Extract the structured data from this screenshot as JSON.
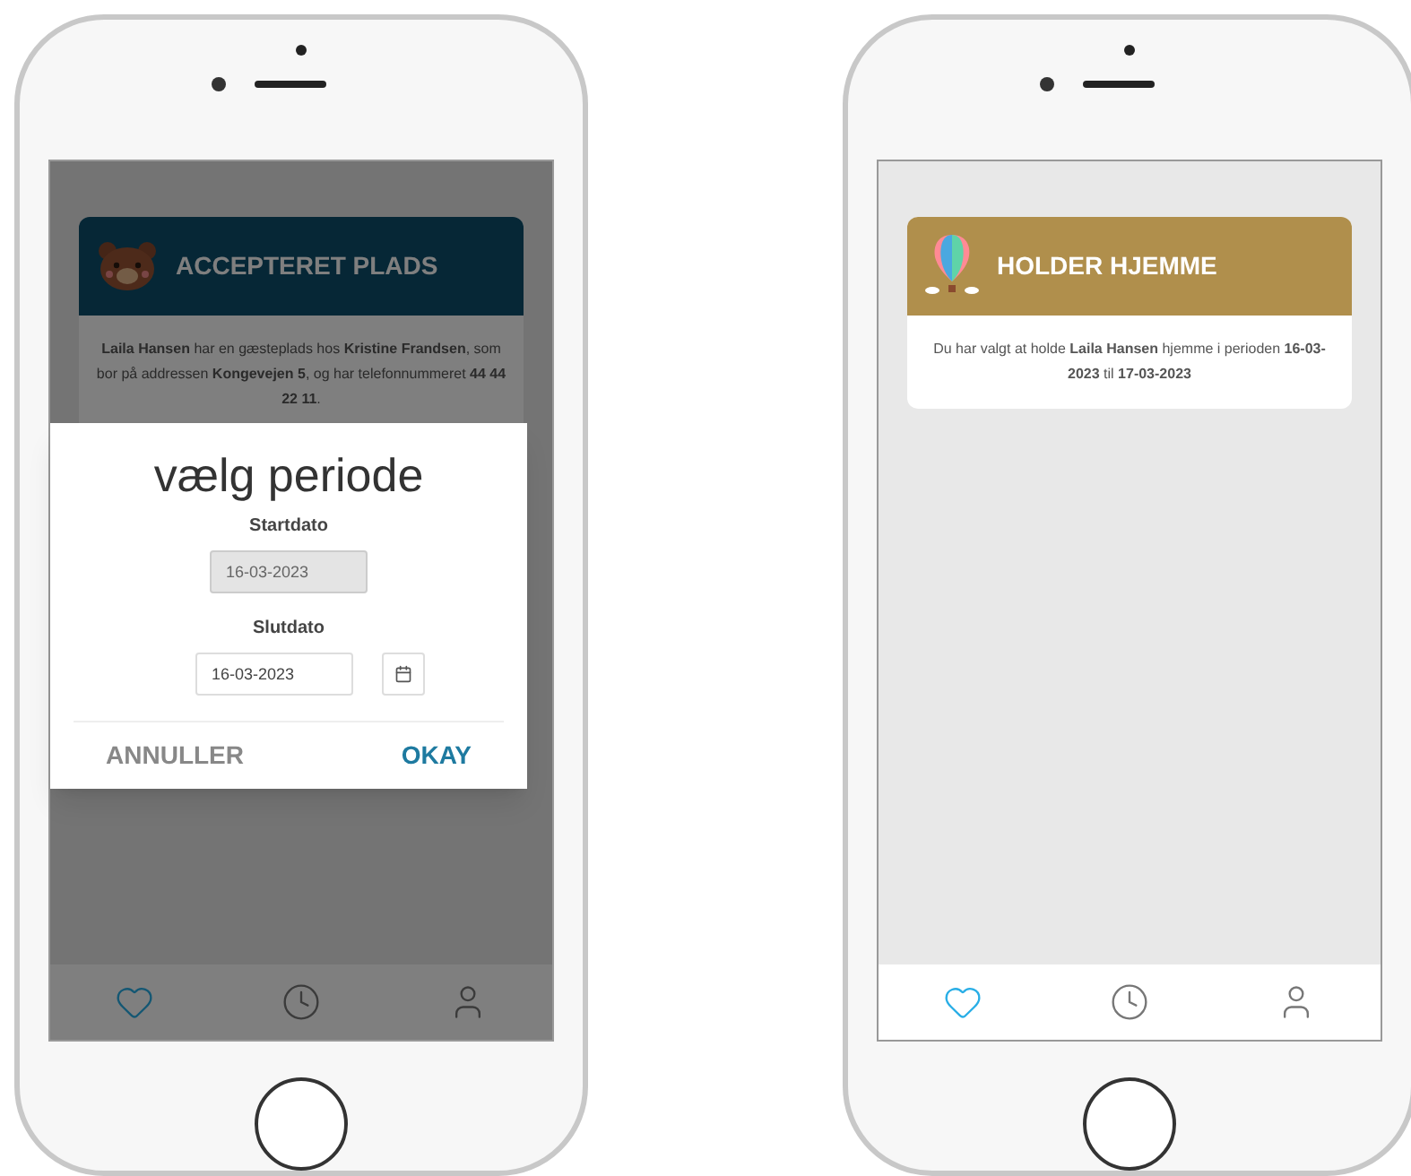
{
  "phones": [
    {
      "card": {
        "kind": "accepted",
        "title": "ACCEPTERET PLADS",
        "text": "**Laila Hansen** har en gæsteplads hos **Kristine Frandsen**, som bor på addressen **Kongevejen 5**, og har telefonnummeret **44 44 22 11**."
      },
      "dialog": {
        "title": "vælg periode",
        "fields": [
          {
            "label": "Startdato",
            "value": "16-03-2023",
            "disabled": true,
            "calendar": false
          },
          {
            "label": "Slutdato",
            "value": "16-03-2023",
            "disabled": false,
            "calendar": true
          }
        ],
        "buttons": [
          {
            "label": "ANNULLER",
            "kind": "cancel"
          },
          {
            "label": "OKAY",
            "kind": "confirm"
          }
        ]
      },
      "nav": [
        {
          "kind": "heart",
          "selected": true
        },
        {
          "kind": "clock",
          "selected": false
        },
        {
          "kind": "user",
          "selected": false
        }
      ]
    },
    {
      "card": {
        "kind": "home",
        "title": "HOLDER HJEMME",
        "text": "Du har valgt at holde **Laila Hansen** hjemme i perioden **16-03-2023** til  **17-03-2023**"
      },
      "nav": [
        {
          "kind": "heart",
          "selected": true
        },
        {
          "kind": "clock",
          "selected": false
        },
        {
          "kind": "user",
          "selected": false
        }
      ]
    }
  ]
}
